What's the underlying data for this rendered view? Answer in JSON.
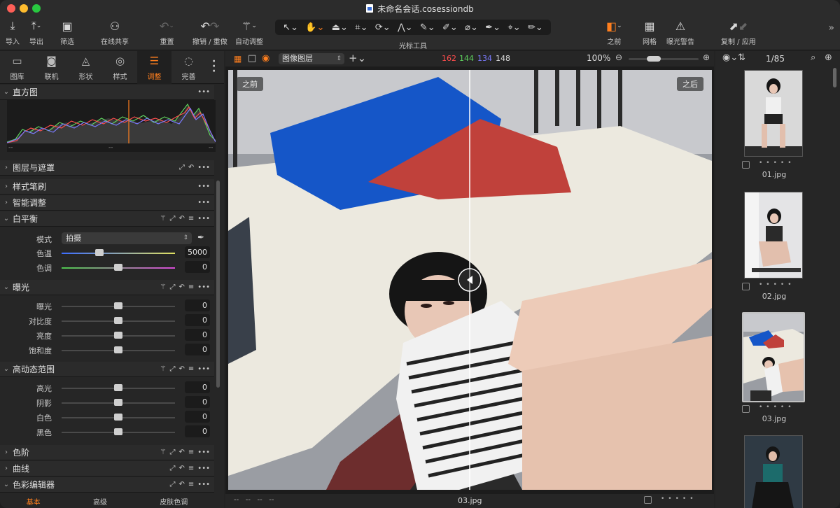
{
  "window": {
    "title": "未命名会话.cosessiondb"
  },
  "toolbar": {
    "import": "导入",
    "export": "导出",
    "filter": "筛选",
    "share": "在线共享",
    "reset": "重置",
    "undo_redo": "撤销 / 重做",
    "auto_adjust": "自动调整",
    "cursor_tools": "光标工具",
    "before": "之前",
    "grid": "网格",
    "exposure_warning": "曝光警告",
    "copy_apply": "复制 / 应用"
  },
  "tool_tabs": [
    {
      "label": "图库"
    },
    {
      "label": "联机"
    },
    {
      "label": "形状"
    },
    {
      "label": "样式"
    },
    {
      "label": "调整"
    },
    {
      "label": "完善"
    }
  ],
  "histogram": {
    "title": "直方图",
    "lab_left": "--",
    "lab_mid": "--",
    "lab_right": "--"
  },
  "sections": {
    "layers": "图层与遮罩",
    "style_brush": "样式笔刷",
    "smart_adjust": "智能调整",
    "white_balance": "白平衡",
    "exposure": "曝光",
    "hdr": "高动态范围",
    "levels": "色阶",
    "curves": "曲线",
    "color_editor": "色彩编辑器"
  },
  "white_balance": {
    "mode_label": "模式",
    "mode_value": "拍摄",
    "temp_label": "色温",
    "temp_value": "5000",
    "tint_label": "色调",
    "tint_value": "0"
  },
  "exposure": [
    {
      "label": "曝光",
      "value": "0"
    },
    {
      "label": "对比度",
      "value": "0"
    },
    {
      "label": "亮度",
      "value": "0"
    },
    {
      "label": "饱和度",
      "value": "0"
    }
  ],
  "hdr": [
    {
      "label": "高光",
      "value": "0"
    },
    {
      "label": "阴影",
      "value": "0"
    },
    {
      "label": "白色",
      "value": "0"
    },
    {
      "label": "黑色",
      "value": "0"
    }
  ],
  "color_editor_tabs": [
    "基本",
    "高级",
    "皮肤色调"
  ],
  "viewer": {
    "layer_select": "图像图层",
    "rgb": {
      "r": "162",
      "g": "144",
      "b": "134",
      "l": "148"
    },
    "zoom": "100%",
    "before_label": "之前",
    "after_label": "之后",
    "filename": "03.jpg",
    "foot_left": "--   --   --   --"
  },
  "browser": {
    "counter": "1/85",
    "items": [
      {
        "name": "01.jpg"
      },
      {
        "name": "02.jpg"
      },
      {
        "name": "03.jpg",
        "selected": true
      }
    ]
  },
  "colors": {
    "accent": "#ff7f1e",
    "red": "#ff4d4d",
    "green": "#5fd35f",
    "blue": "#7b7bff"
  }
}
